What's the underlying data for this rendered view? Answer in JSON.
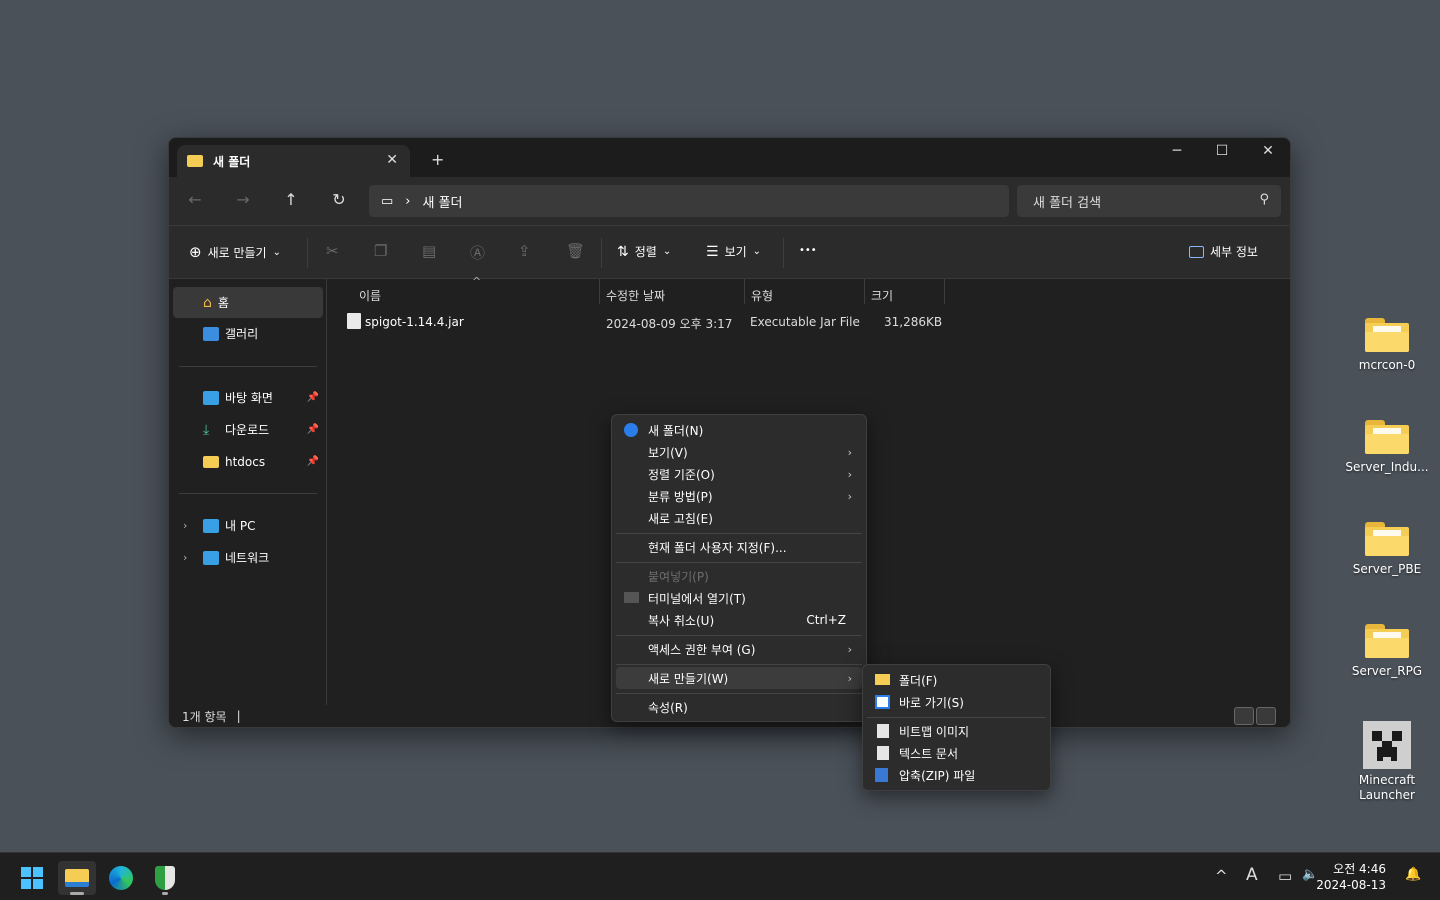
{
  "desktop": {
    "icons": [
      {
        "label": "mcrcon-0"
      },
      {
        "label": "Server_Indu..."
      },
      {
        "label": "Server_PBE"
      },
      {
        "label": "Server_RPG"
      },
      {
        "label": "Minecraft Launcher"
      }
    ]
  },
  "window": {
    "tab_title": "새 폴더",
    "tab_close": "✕",
    "new_tab": "+",
    "minimize": "─",
    "maximize": "☐",
    "close": "✕"
  },
  "nav": {
    "back": "←",
    "forward": "→",
    "up": "↑",
    "refresh": "↻",
    "pc_icon": "▭",
    "sep": "›",
    "path": "새 폴더",
    "search_placeholder": "새 폴더 검색",
    "search_icon": "⚲"
  },
  "toolbar": {
    "new_label": "새로 만들기",
    "new_icon": "⊕",
    "sort_label": "정렬",
    "view_label": "보기",
    "more": "•••",
    "details_label": "세부 정보",
    "dropdown": "⌄"
  },
  "sidebar": {
    "home": "홈",
    "gallery": "갤러리",
    "desktop": "바탕 화면",
    "downloads": "다운로드",
    "htdocs": "htdocs",
    "mypc": "내 PC",
    "network": "네트워크",
    "pin": "📌",
    "chevron": "›"
  },
  "filelist": {
    "columns": [
      "이름",
      "수정한 날짜",
      "유형",
      "크기"
    ],
    "sort_caret": "^",
    "rows": [
      {
        "name": "spigot-1.14.4.jar",
        "modified": "2024-08-09 오후 3:17",
        "type": "Executable Jar File",
        "size": "31,286KB"
      }
    ]
  },
  "status": {
    "count": "1개 항목",
    "cursor": "|"
  },
  "context_menu": {
    "items": [
      {
        "label": "새 폴더(N)"
      },
      {
        "label": "보기(V)"
      },
      {
        "label": "정렬 기준(O)"
      },
      {
        "label": "분류 방법(P)"
      },
      {
        "label": "새로 고침(E)"
      },
      {
        "label": "현재 폴더 사용자 지정(F)..."
      },
      {
        "label": "붙여넣기(P)"
      },
      {
        "label": "터미널에서 열기(T)"
      },
      {
        "label": "복사 취소(U)",
        "shortcut": "Ctrl+Z"
      },
      {
        "label": "액세스 권한 부여 (G)"
      },
      {
        "label": "새로 만들기(W)"
      },
      {
        "label": "속성(R)"
      }
    ],
    "arrow": "›"
  },
  "submenu": {
    "items": [
      {
        "label": "폴더(F)"
      },
      {
        "label": "바로 가기(S)"
      },
      {
        "label": "비트맵 이미지"
      },
      {
        "label": "텍스트 문서"
      },
      {
        "label": "압축(ZIP) 파일"
      }
    ]
  },
  "taskbar": {
    "tray_up": "^",
    "ime": "A",
    "network": "▭",
    "volume": "🔈",
    "time": "오전 4:46",
    "date": "2024-08-13",
    "bell": "🔔"
  }
}
